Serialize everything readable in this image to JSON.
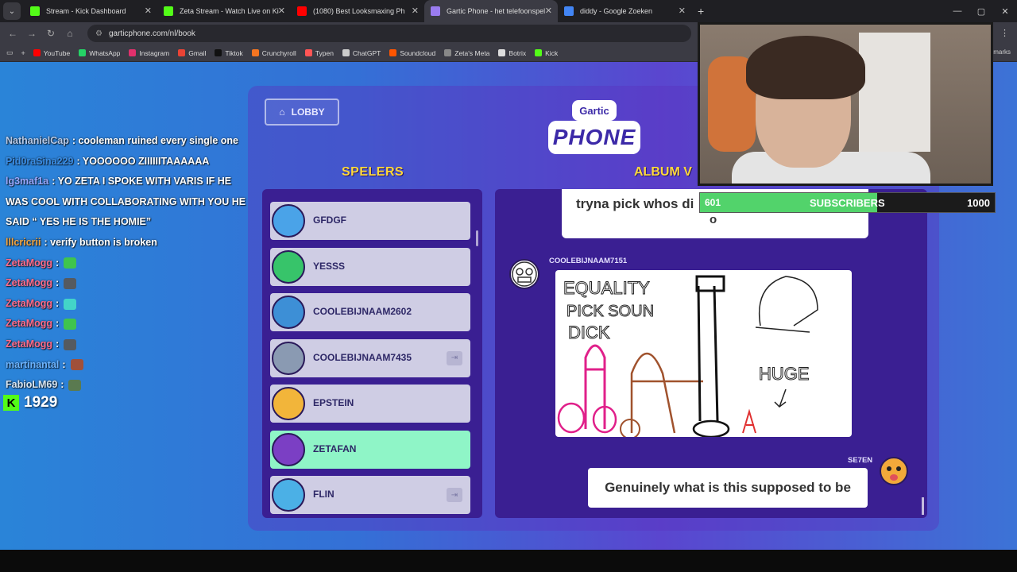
{
  "browser": {
    "tabs": [
      {
        "title": "Stream - Kick Dashboard",
        "favicon_color": "#53fc18",
        "active": false
      },
      {
        "title": "Zeta Stream - Watch Live on Ki",
        "favicon_color": "#53fc18",
        "active": false
      },
      {
        "title": "(1080) Best Looksmaxing Ph",
        "favicon_color": "#ff0000",
        "active": false
      },
      {
        "title": "Gartic Phone - het telefoonspel",
        "favicon_color": "#9a7cf0",
        "active": true
      },
      {
        "title": "diddy - Google Zoeken",
        "favicon_color": "#4285f4",
        "active": false
      }
    ],
    "new_tab": "+",
    "url": "garticphone.com/nl/book",
    "bookmarks": [
      {
        "label": "YouTube",
        "color": "#ff0000"
      },
      {
        "label": "WhatsApp",
        "color": "#25d366"
      },
      {
        "label": "Instagram",
        "color": "#e1306c"
      },
      {
        "label": "Gmail",
        "color": "#ea4335"
      },
      {
        "label": "Tiktok",
        "color": "#111111"
      },
      {
        "label": "Crunchyroll",
        "color": "#f47521"
      },
      {
        "label": "Typen",
        "color": "#ff5555"
      },
      {
        "label": "ChatGPT",
        "color": "#cccccc"
      },
      {
        "label": "Soundcloud",
        "color": "#ff5500"
      },
      {
        "label": "Zeta's Meta",
        "color": "#888888"
      },
      {
        "label": "Botrix",
        "color": "#dddddd"
      },
      {
        "label": "Kick",
        "color": "#53fc18"
      }
    ],
    "bookmarks_more": "marks"
  },
  "chat": {
    "messages": [
      {
        "user": "NathanielCap",
        "user_color": "#b7c9e6",
        "text": ": cooleman ruined every single one"
      },
      {
        "user": "Pid0raSina229",
        "user_color": "#3b8fe8",
        "text": ": YOOOOOO ZIIIIIITAAAAAA"
      },
      {
        "user": "lg3maf1a",
        "user_color": "#9aa8ff",
        "text": ": YO ZETA I SPOKE WITH VARIS IF HE"
      },
      {
        "user": "",
        "user_color": "#ffffff",
        "text": "WAS COOL WITH COLLABORATING WITH YOU HE"
      },
      {
        "user": "",
        "user_color": "#ffffff",
        "text": "SAID “ YES HE IS THE HOMIE”"
      },
      {
        "user": "lllcricrii",
        "user_color": "#f4a640",
        "text": ": verify button is broken"
      },
      {
        "user": "ZetaMogg",
        "user_color": "#ff6b8a",
        "text": ":"
      },
      {
        "user": "ZetaMogg",
        "user_color": "#ff6b8a",
        "text": ":"
      },
      {
        "user": "ZetaMogg",
        "user_color": "#ff6b8a",
        "text": ":"
      },
      {
        "user": "ZetaMogg",
        "user_color": "#ff6b8a",
        "text": ":"
      },
      {
        "user": "ZetaMogg",
        "user_color": "#ff6b8a",
        "text": ":"
      },
      {
        "user": "martinantal",
        "user_color": "#6cb4ff",
        "text": ":"
      },
      {
        "user": "FabioLM69",
        "user_color": "#d9e6f2",
        "text": ":"
      }
    ],
    "viewer_count": "1929",
    "kick_letter": "K"
  },
  "game": {
    "lobby_label": "LOBBY",
    "logo_top": "Gartic",
    "logo_bottom": "PHONE",
    "players_title": "SPELERS",
    "album_title": "ALBUM V",
    "players": [
      {
        "name": "GFDGF",
        "avatar_color": "#4aa3e8",
        "highlight": false,
        "kick": false
      },
      {
        "name": "YESSS",
        "avatar_color": "#37c46a",
        "highlight": false,
        "kick": false
      },
      {
        "name": "COOLEBIJNAAM2602",
        "avatar_color": "#3d8fd6",
        "highlight": false,
        "kick": false
      },
      {
        "name": "COOLEBIJNAAM7435",
        "avatar_color": "#8a9ab2",
        "highlight": false,
        "kick": true
      },
      {
        "name": "EPSTEIN",
        "avatar_color": "#f2b53a",
        "highlight": false,
        "kick": false
      },
      {
        "name": "ZETAFAN",
        "avatar_color": "#7b3fc4",
        "highlight": true,
        "kick": false
      },
      {
        "name": "FLIN",
        "avatar_color": "#4bb0e6",
        "highlight": false,
        "kick": true
      }
    ],
    "album": {
      "prev_text_line1": "tryna pick whos di",
      "prev_text_line2": "o",
      "drawing_author": "COOLEBIJNAAM7151",
      "drawing_words": [
        "EQUALITY",
        "PICK SOUN",
        "DICK",
        "HUGE"
      ],
      "answer_author": "SE7EN",
      "answer_text": "Genuinely what is this supposed to be"
    }
  },
  "subscribers": {
    "current": "601",
    "label": "SUBSCRIBERS",
    "goal": "1000",
    "progress": 0.6
  }
}
